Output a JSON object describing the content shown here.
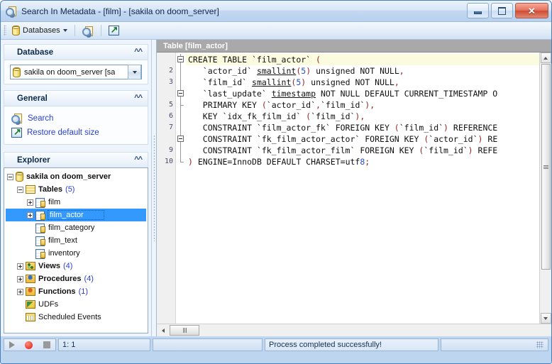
{
  "window": {
    "title": "Search In Metadata - [film] - [sakila on doom_server]",
    "app_icon": "search-metadata-icon",
    "minimize_label": "Minimize",
    "maximize_label": "Maximize",
    "close_label": "Close"
  },
  "toolbar": {
    "databases_label": "Databases",
    "databases_icon": "database-icon",
    "search_icon": "search-magnifier-icon",
    "restore_icon": "restore-size-icon"
  },
  "sidebar": {
    "panels": [
      {
        "title": "Database",
        "collapse_icon": "chevron-up-double-icon"
      },
      {
        "title": "General",
        "collapse_icon": "chevron-up-double-icon"
      },
      {
        "title": "Explorer",
        "collapse_icon": "chevron-up-double-icon"
      }
    ],
    "database_combo": {
      "value": "sakila on doom_server [sa",
      "icon": "database-icon",
      "dropdown_icon": "caret-down-icon"
    },
    "general_links": [
      {
        "label": "Search",
        "icon": "search-magnifier-icon"
      },
      {
        "label": "Restore default size",
        "icon": "restore-size-icon"
      }
    ],
    "tree": [
      {
        "label": "sakila on doom_server",
        "icon": "database-icon",
        "indent": 0,
        "toggle": "minus",
        "bold": true,
        "count": "",
        "selected": false
      },
      {
        "label": "Tables",
        "icon": "tables-folder-icon",
        "indent": 1,
        "toggle": "minus",
        "bold": true,
        "count": "(5)",
        "selected": false
      },
      {
        "label": "film",
        "icon": "table-icon",
        "indent": 2,
        "toggle": "plus",
        "bold": false,
        "count": "",
        "selected": false
      },
      {
        "label": "film_actor",
        "icon": "table-icon",
        "indent": 2,
        "toggle": "plus",
        "bold": false,
        "count": "",
        "selected": true
      },
      {
        "label": "film_category",
        "icon": "table-icon",
        "indent": 2,
        "toggle": "none",
        "bold": false,
        "count": "",
        "selected": false
      },
      {
        "label": "film_text",
        "icon": "table-icon",
        "indent": 2,
        "toggle": "none",
        "bold": false,
        "count": "",
        "selected": false
      },
      {
        "label": "inventory",
        "icon": "table-icon",
        "indent": 2,
        "toggle": "none",
        "bold": false,
        "count": "",
        "selected": false
      },
      {
        "label": "Views",
        "icon": "views-folder-icon",
        "indent": 1,
        "toggle": "plus",
        "bold": true,
        "count": "(4)",
        "selected": false
      },
      {
        "label": "Procedures",
        "icon": "procedures-folder-icon",
        "indent": 1,
        "toggle": "plus",
        "bold": true,
        "count": "(4)",
        "selected": false
      },
      {
        "label": "Functions",
        "icon": "functions-folder-icon",
        "indent": 1,
        "toggle": "plus",
        "bold": true,
        "count": "(1)",
        "selected": false
      },
      {
        "label": "UDFs",
        "icon": "udf-folder-icon",
        "indent": 1,
        "toggle": "none",
        "bold": false,
        "count": "",
        "selected": false
      },
      {
        "label": "Scheduled Events",
        "icon": "events-folder-icon",
        "indent": 1,
        "toggle": "none",
        "bold": false,
        "count": "",
        "selected": false
      }
    ]
  },
  "editor": {
    "tab_title": "Table [film_actor]",
    "lines": [
      {
        "num": "",
        "fold": "box",
        "highlight": true,
        "text": "CREATE TABLE `film_actor` ("
      },
      {
        "num": "2",
        "fold": "line",
        "highlight": false,
        "text": "   `actor_id` smallint(5) unsigned NOT NULL,"
      },
      {
        "num": "3",
        "fold": "line",
        "highlight": false,
        "text": "   `film_id` smallint(5) unsigned NOT NULL,"
      },
      {
        "num": "",
        "fold": "box",
        "highlight": false,
        "text": "   `last_update` timestamp NOT NULL DEFAULT CURRENT_TIMESTAMP O"
      },
      {
        "num": "5",
        "fold": "end",
        "highlight": false,
        "text": "   PRIMARY KEY (`actor_id`,`film_id`),"
      },
      {
        "num": "6",
        "fold": "line",
        "highlight": false,
        "text": "   KEY `idx_fk_film_id` (`film_id`),"
      },
      {
        "num": "7",
        "fold": "line",
        "highlight": false,
        "text": "   CONSTRAINT `film_actor_fk` FOREIGN KEY (`film_id`) REFERENCE"
      },
      {
        "num": "",
        "fold": "box",
        "highlight": false,
        "text": "   CONSTRAINT `fk_film_actor_actor` FOREIGN KEY (`actor_id`) RE"
      },
      {
        "num": "9",
        "fold": "line",
        "highlight": false,
        "text": "   CONSTRAINT `fk_film_actor_film` FOREIGN KEY (`film_id`) REFE"
      },
      {
        "num": "10",
        "fold": "close",
        "highlight": false,
        "text": ") ENGINE=InnoDB DEFAULT CHARSET=utf8;"
      }
    ],
    "scroll_up_icon": "scroll-up-arrow-icon",
    "scroll_down_icon": "scroll-down-arrow-icon",
    "scroll_left_icon": "scroll-left-arrow-icon"
  },
  "statusbar": {
    "play_icon": "play-icon",
    "record_icon": "record-icon",
    "stop_icon": "stop-icon",
    "position": "1:  1",
    "field_a": "",
    "message": "Process completed successfully!",
    "resize_grip_icon": "resize-grip-icon"
  },
  "colors": {
    "accent": "#3399ff",
    "link": "#2a3fd0",
    "tab_header": "#a9a9a9",
    "highlight_line": "#fbfbe0",
    "number_literal": "#2a4fd0",
    "punctuation": "#9c2020"
  }
}
